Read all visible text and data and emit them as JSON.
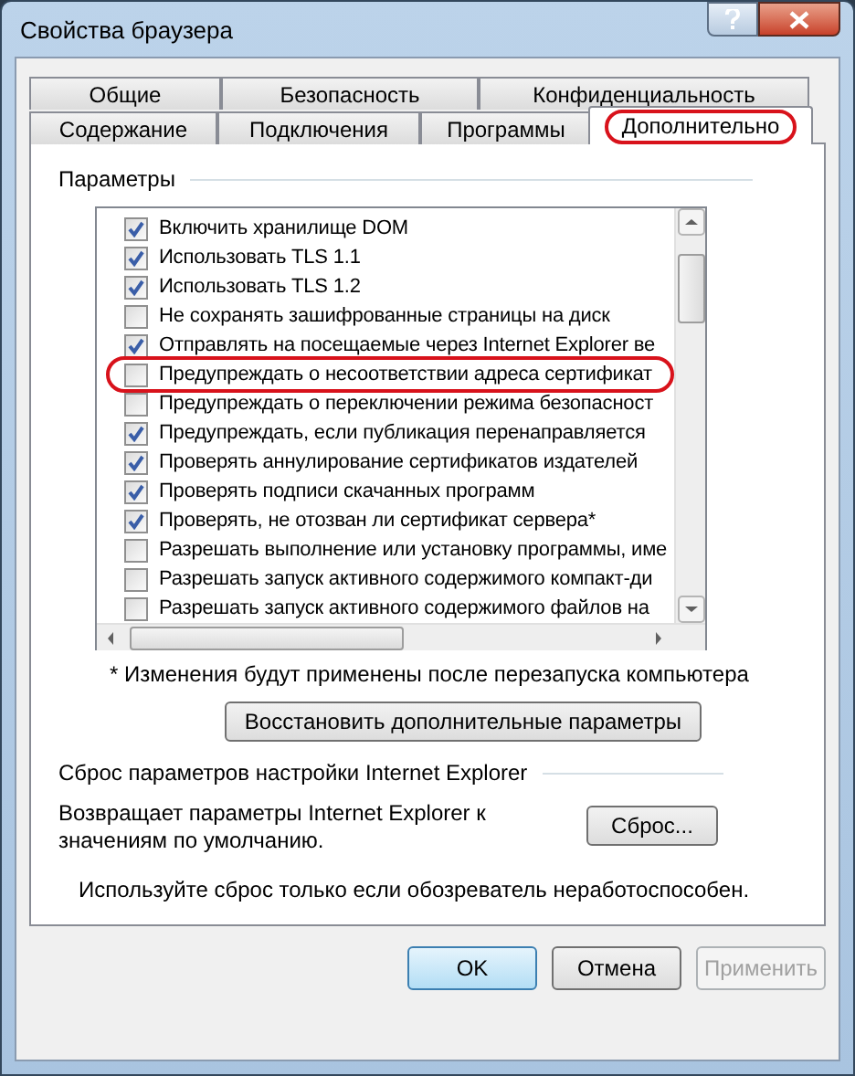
{
  "window": {
    "title": "Свойства браузера"
  },
  "tab_rows": [
    {
      "tabs": [
        {
          "label": "Общие",
          "selected": false,
          "annotated": false
        },
        {
          "label": "Безопасность",
          "selected": false,
          "annotated": false
        },
        {
          "label": "Конфиденциальность",
          "selected": false,
          "annotated": false
        }
      ]
    },
    {
      "tabs": [
        {
          "label": "Содержание",
          "selected": false,
          "annotated": false
        },
        {
          "label": "Подключения",
          "selected": false,
          "annotated": false
        },
        {
          "label": "Программы",
          "selected": false,
          "annotated": false
        },
        {
          "label": "Дополнительно",
          "selected": true,
          "annotated": true
        }
      ]
    }
  ],
  "settings": {
    "title": "Параметры",
    "items": [
      {
        "label": "Включить хранилище DOM",
        "checked": true,
        "annotated": false
      },
      {
        "label": "Использовать TLS 1.1",
        "checked": true,
        "annotated": false
      },
      {
        "label": "Использовать TLS 1.2",
        "checked": true,
        "annotated": false
      },
      {
        "label": "Не сохранять зашифрованные страницы на диск",
        "checked": false,
        "annotated": false
      },
      {
        "label": "Отправлять на посещаемые через Internet Explorer ве",
        "checked": true,
        "annotated": false
      },
      {
        "label": "Предупреждать о несоответствии адреса сертификат",
        "checked": false,
        "annotated": true
      },
      {
        "label": "Предупреждать о переключении режима безопасност",
        "checked": false,
        "annotated": false
      },
      {
        "label": "Предупреждать, если публикация перенаправляется",
        "checked": true,
        "annotated": false
      },
      {
        "label": "Проверять аннулирование сертификатов издателей",
        "checked": true,
        "annotated": false
      },
      {
        "label": "Проверять подписи скачанных программ",
        "checked": true,
        "annotated": false
      },
      {
        "label": "Проверять, не отозван ли сертификат сервера*",
        "checked": true,
        "annotated": false
      },
      {
        "label": "Разрешать выполнение или установку программы, име",
        "checked": false,
        "annotated": false
      },
      {
        "label": "Разрешать запуск активного содержимого компакт-ди",
        "checked": false,
        "annotated": false
      },
      {
        "label": "Разрешать запуск активного содержимого файлов на",
        "checked": false,
        "annotated": false
      }
    ],
    "note": "* Изменения будут применены после перезапуска компьютера",
    "restore_button": "Восстановить дополнительные параметры"
  },
  "reset": {
    "title": "Сброс параметров настройки Internet Explorer",
    "description": "Возвращает параметры Internet Explorer к значениям по умолчанию.",
    "button": "Сброс...",
    "hint": "Используйте сброс только если обозреватель неработоспособен."
  },
  "buttons": [
    {
      "label": "OK",
      "kind": "default",
      "disabled": false
    },
    {
      "label": "Отмена",
      "kind": "normal",
      "disabled": false
    },
    {
      "label": "Применить",
      "kind": "normal",
      "disabled": true
    }
  ]
}
